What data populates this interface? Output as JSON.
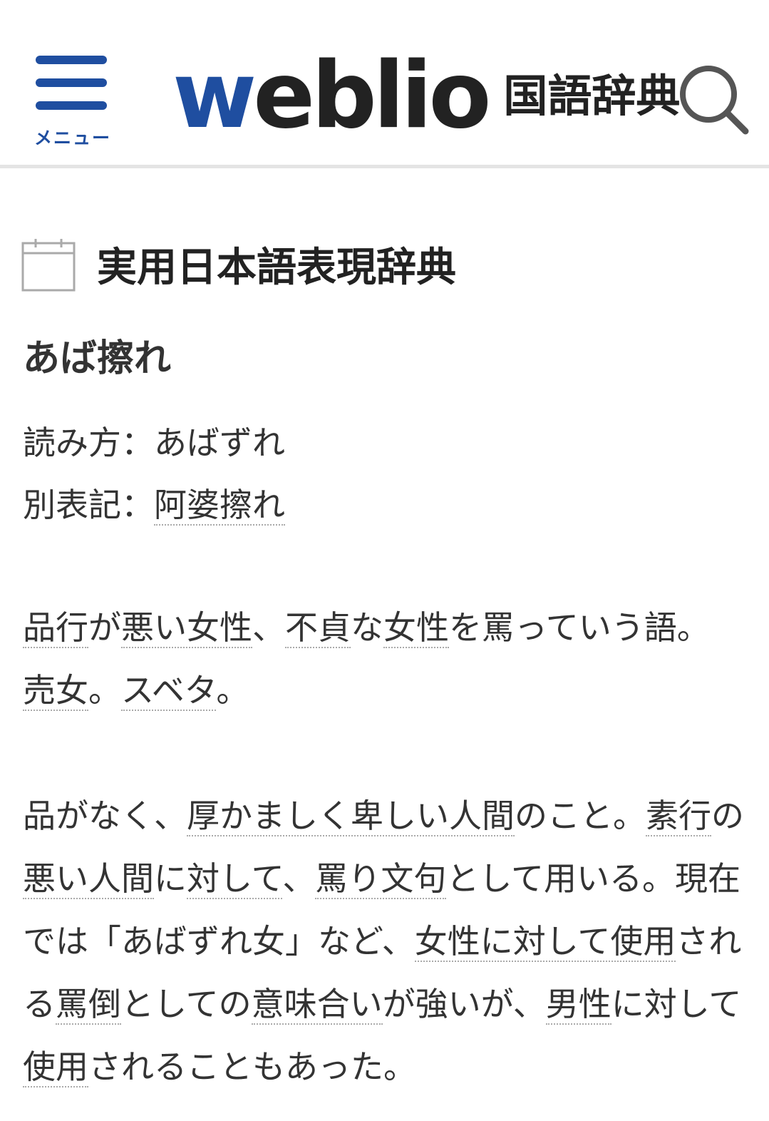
{
  "header": {
    "menu_label": "メニュー",
    "logo_w": "w",
    "logo_rest": "eblio",
    "logo_sub": "国語辞典",
    "brand_color": "#1f4ea0"
  },
  "section": {
    "title": "実用日本語表現辞典",
    "icon": "calendar-icon"
  },
  "entry": {
    "term": "あば擦れ",
    "reading_label": "読み方：",
    "reading": "あばずれ",
    "alt_label": "別表記：",
    "alt": "阿婆擦れ"
  },
  "para1": {
    "s1": "品行",
    "s2": "が",
    "s3": "悪い女性",
    "s4": "、",
    "s5": "不貞",
    "s6": "な",
    "s7": "女性",
    "s8": "を罵っていう語。",
    "s9": "売女",
    "s10": "。",
    "s11": "スベタ",
    "s12": "。"
  },
  "para2": {
    "s1": "品がなく、",
    "s2": "厚かましく卑しい人間",
    "s3": "のこと。",
    "s4": "素行",
    "s5": "の",
    "s6": "悪い人間",
    "s7": "に",
    "s8": "対して",
    "s9": "、",
    "s10": "罵り文句",
    "s11": "として用いる。現在では「あばずれ女」など、",
    "s12": "女性に対して使用",
    "s13": "される",
    "s14": "罵倒",
    "s15": "としての",
    "s16": "意味合い",
    "s17": "が強いが、",
    "s18": "男性",
    "s19": "に対して",
    "s20": "使用",
    "s21": "されることもあった。"
  }
}
